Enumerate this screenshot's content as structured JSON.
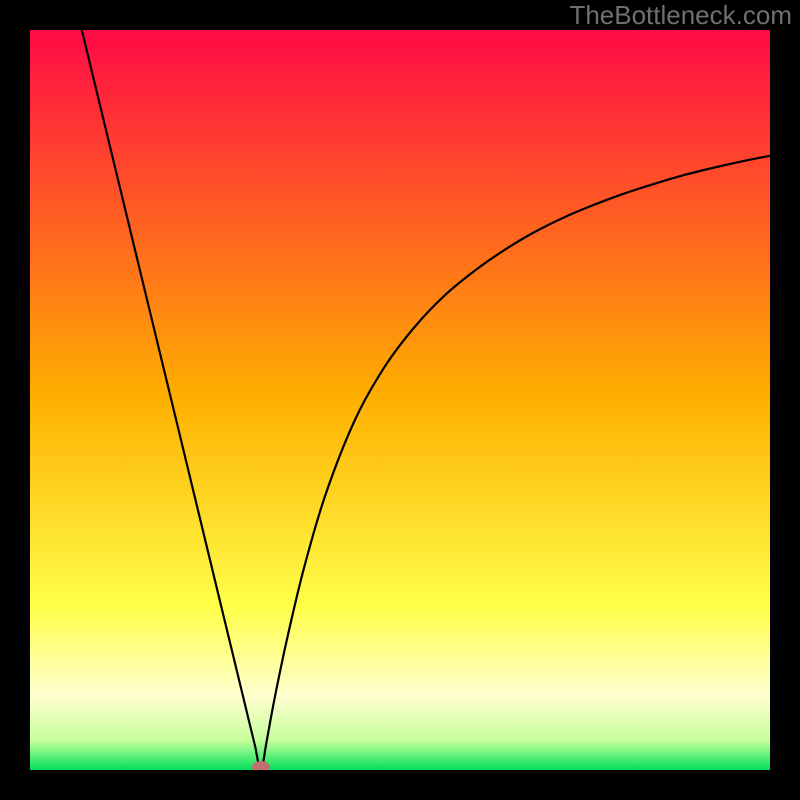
{
  "watermark": "TheBottleneck.com",
  "chart_data": {
    "type": "line",
    "title": "",
    "xlabel": "",
    "ylabel": "",
    "xlim": [
      0,
      100
    ],
    "ylim": [
      0,
      100
    ],
    "grid": false,
    "legend": false,
    "background_gradient": {
      "stops": [
        {
          "pos": 0.0,
          "color": "#ff0a46"
        },
        {
          "pos": 0.5,
          "color": "#ffb000"
        },
        {
          "pos": 0.78,
          "color": "#ffff4a"
        },
        {
          "pos": 0.9,
          "color": "#ffffd0"
        },
        {
          "pos": 0.96,
          "color": "#c6ff9a"
        },
        {
          "pos": 1.0,
          "color": "#00e15a"
        }
      ]
    },
    "marker": {
      "x": 31.2,
      "y": 0.4,
      "color": "#c07070"
    },
    "series": [
      {
        "name": "curve",
        "color": "#000000",
        "x": [
          7.0,
          10.0,
          13.0,
          16.0,
          19.0,
          22.0,
          25.0,
          28.0,
          29.5,
          30.4,
          31.2,
          32.0,
          33.0,
          34.6,
          37.0,
          40.0,
          44.0,
          48.0,
          52.0,
          56.0,
          60.0,
          64.0,
          68.0,
          72.0,
          76.0,
          80.0,
          84.0,
          88.0,
          92.0,
          96.0,
          100.0
        ],
        "y": [
          100.0,
          87.6,
          75.2,
          62.8,
          50.4,
          38.0,
          25.6,
          13.2,
          7.0,
          3.3,
          0.0,
          4.0,
          9.4,
          17.1,
          27.2,
          37.4,
          47.5,
          54.6,
          59.9,
          64.1,
          67.4,
          70.2,
          72.6,
          74.6,
          76.3,
          77.8,
          79.1,
          80.3,
          81.3,
          82.2,
          83.0
        ]
      }
    ]
  }
}
